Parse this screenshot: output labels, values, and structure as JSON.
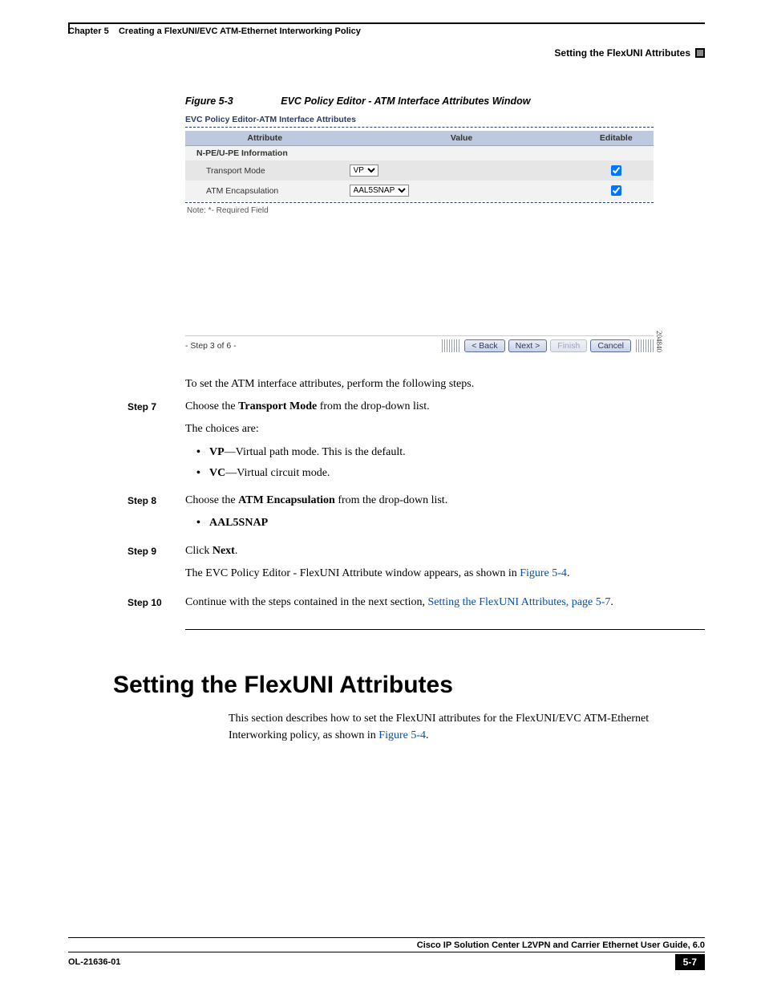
{
  "header": {
    "chapter_label": "Chapter 5",
    "chapter_title": "Creating a FlexUNI/EVC ATM-Ethernet Interworking Policy",
    "section_right": "Setting the FlexUNI Attributes"
  },
  "figure": {
    "label": "Figure 5-3",
    "title": "EVC Policy Editor - ATM Interface Attributes Window",
    "image_id": "204840"
  },
  "widget": {
    "title": "EVC Policy Editor-ATM Interface Attributes",
    "columns": {
      "attribute": "Attribute",
      "value": "Value",
      "editable": "Editable"
    },
    "subheader": "N-PE/U-PE Information",
    "rows": [
      {
        "attribute": "Transport Mode",
        "value": "VP",
        "editable_checked": true
      },
      {
        "attribute": "ATM Encapsulation",
        "value": "AAL5SNAP",
        "editable_checked": true
      }
    ],
    "note": "Note: *- Required Field",
    "step_indicator": "- Step 3 of 6 -",
    "buttons": {
      "back": "< Back",
      "next": "Next >",
      "finish": "Finish",
      "cancel": "Cancel"
    }
  },
  "body": {
    "intro": "To set the ATM interface attributes, perform the following steps.",
    "steps": {
      "s7": {
        "label": "Step 7",
        "line1_pre": "Choose the ",
        "line1_bold": "Transport Mode",
        "line1_post": " from the drop-down list.",
        "choices_lead": "The choices are:",
        "vp_bold": "VP",
        "vp_desc": "—Virtual path mode. This is the default.",
        "vc_bold": "VC",
        "vc_desc": "—Virtual circuit mode."
      },
      "s8": {
        "label": "Step 8",
        "line1_pre": "Choose the ",
        "line1_bold": "ATM Encapsulation",
        "line1_post": " from the drop-down list.",
        "bullet_bold": "AAL5SNAP"
      },
      "s9": {
        "label": "Step 9",
        "line1_pre": "Click ",
        "line1_bold": "Next",
        "line1_post": ".",
        "line2_pre": "The EVC Policy Editor - FlexUNI Attribute window appears, as shown in ",
        "line2_link": "Figure 5-4",
        "line2_post": "."
      },
      "s10": {
        "label": "Step 10",
        "line1_pre": "Continue with the steps contained in the next section, ",
        "line1_link": "Setting the FlexUNI Attributes, page 5-7",
        "line1_post": "."
      }
    }
  },
  "section": {
    "heading": "Setting the FlexUNI Attributes",
    "intro_pre": "This section describes how to set the FlexUNI attributes for the FlexUNI/EVC ATM-Ethernet Interworking policy, as shown in ",
    "intro_link": "Figure 5-4",
    "intro_post": "."
  },
  "footer": {
    "guide_title": "Cisco IP Solution Center L2VPN and Carrier Ethernet User Guide, 6.0",
    "doc_id": "OL-21636-01",
    "page_num": "5-7"
  }
}
